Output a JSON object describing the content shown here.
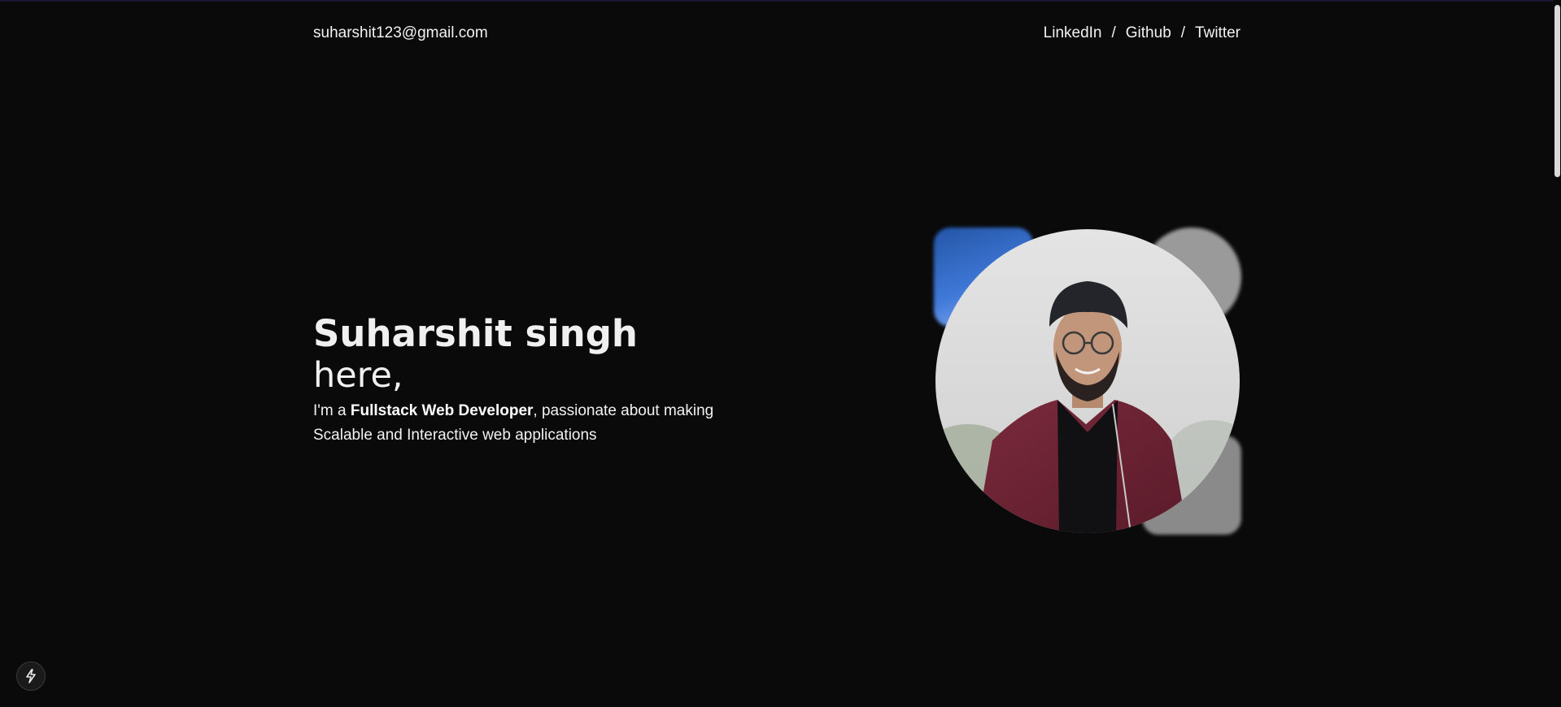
{
  "header": {
    "email": "suharshit123@gmail.com",
    "links": [
      {
        "label": "LinkedIn"
      },
      {
        "label": "Github"
      },
      {
        "label": "Twitter"
      }
    ],
    "separator": "/"
  },
  "hero": {
    "name": "Suharshit singh",
    "here": "here,",
    "intro_prefix": "I'm a ",
    "intro_bold": "Fullstack Web Developer",
    "intro_suffix": ", passionate about making Scalable and Interactive web applications"
  },
  "colors": {
    "background": "#0a0a0b",
    "text": "#f2f2f2",
    "accent_blue": "#3f78d8",
    "deco_gray": "#9a9a9a"
  },
  "icons": {
    "profile_photo": "profile-photo",
    "fab": "lightning-icon"
  }
}
